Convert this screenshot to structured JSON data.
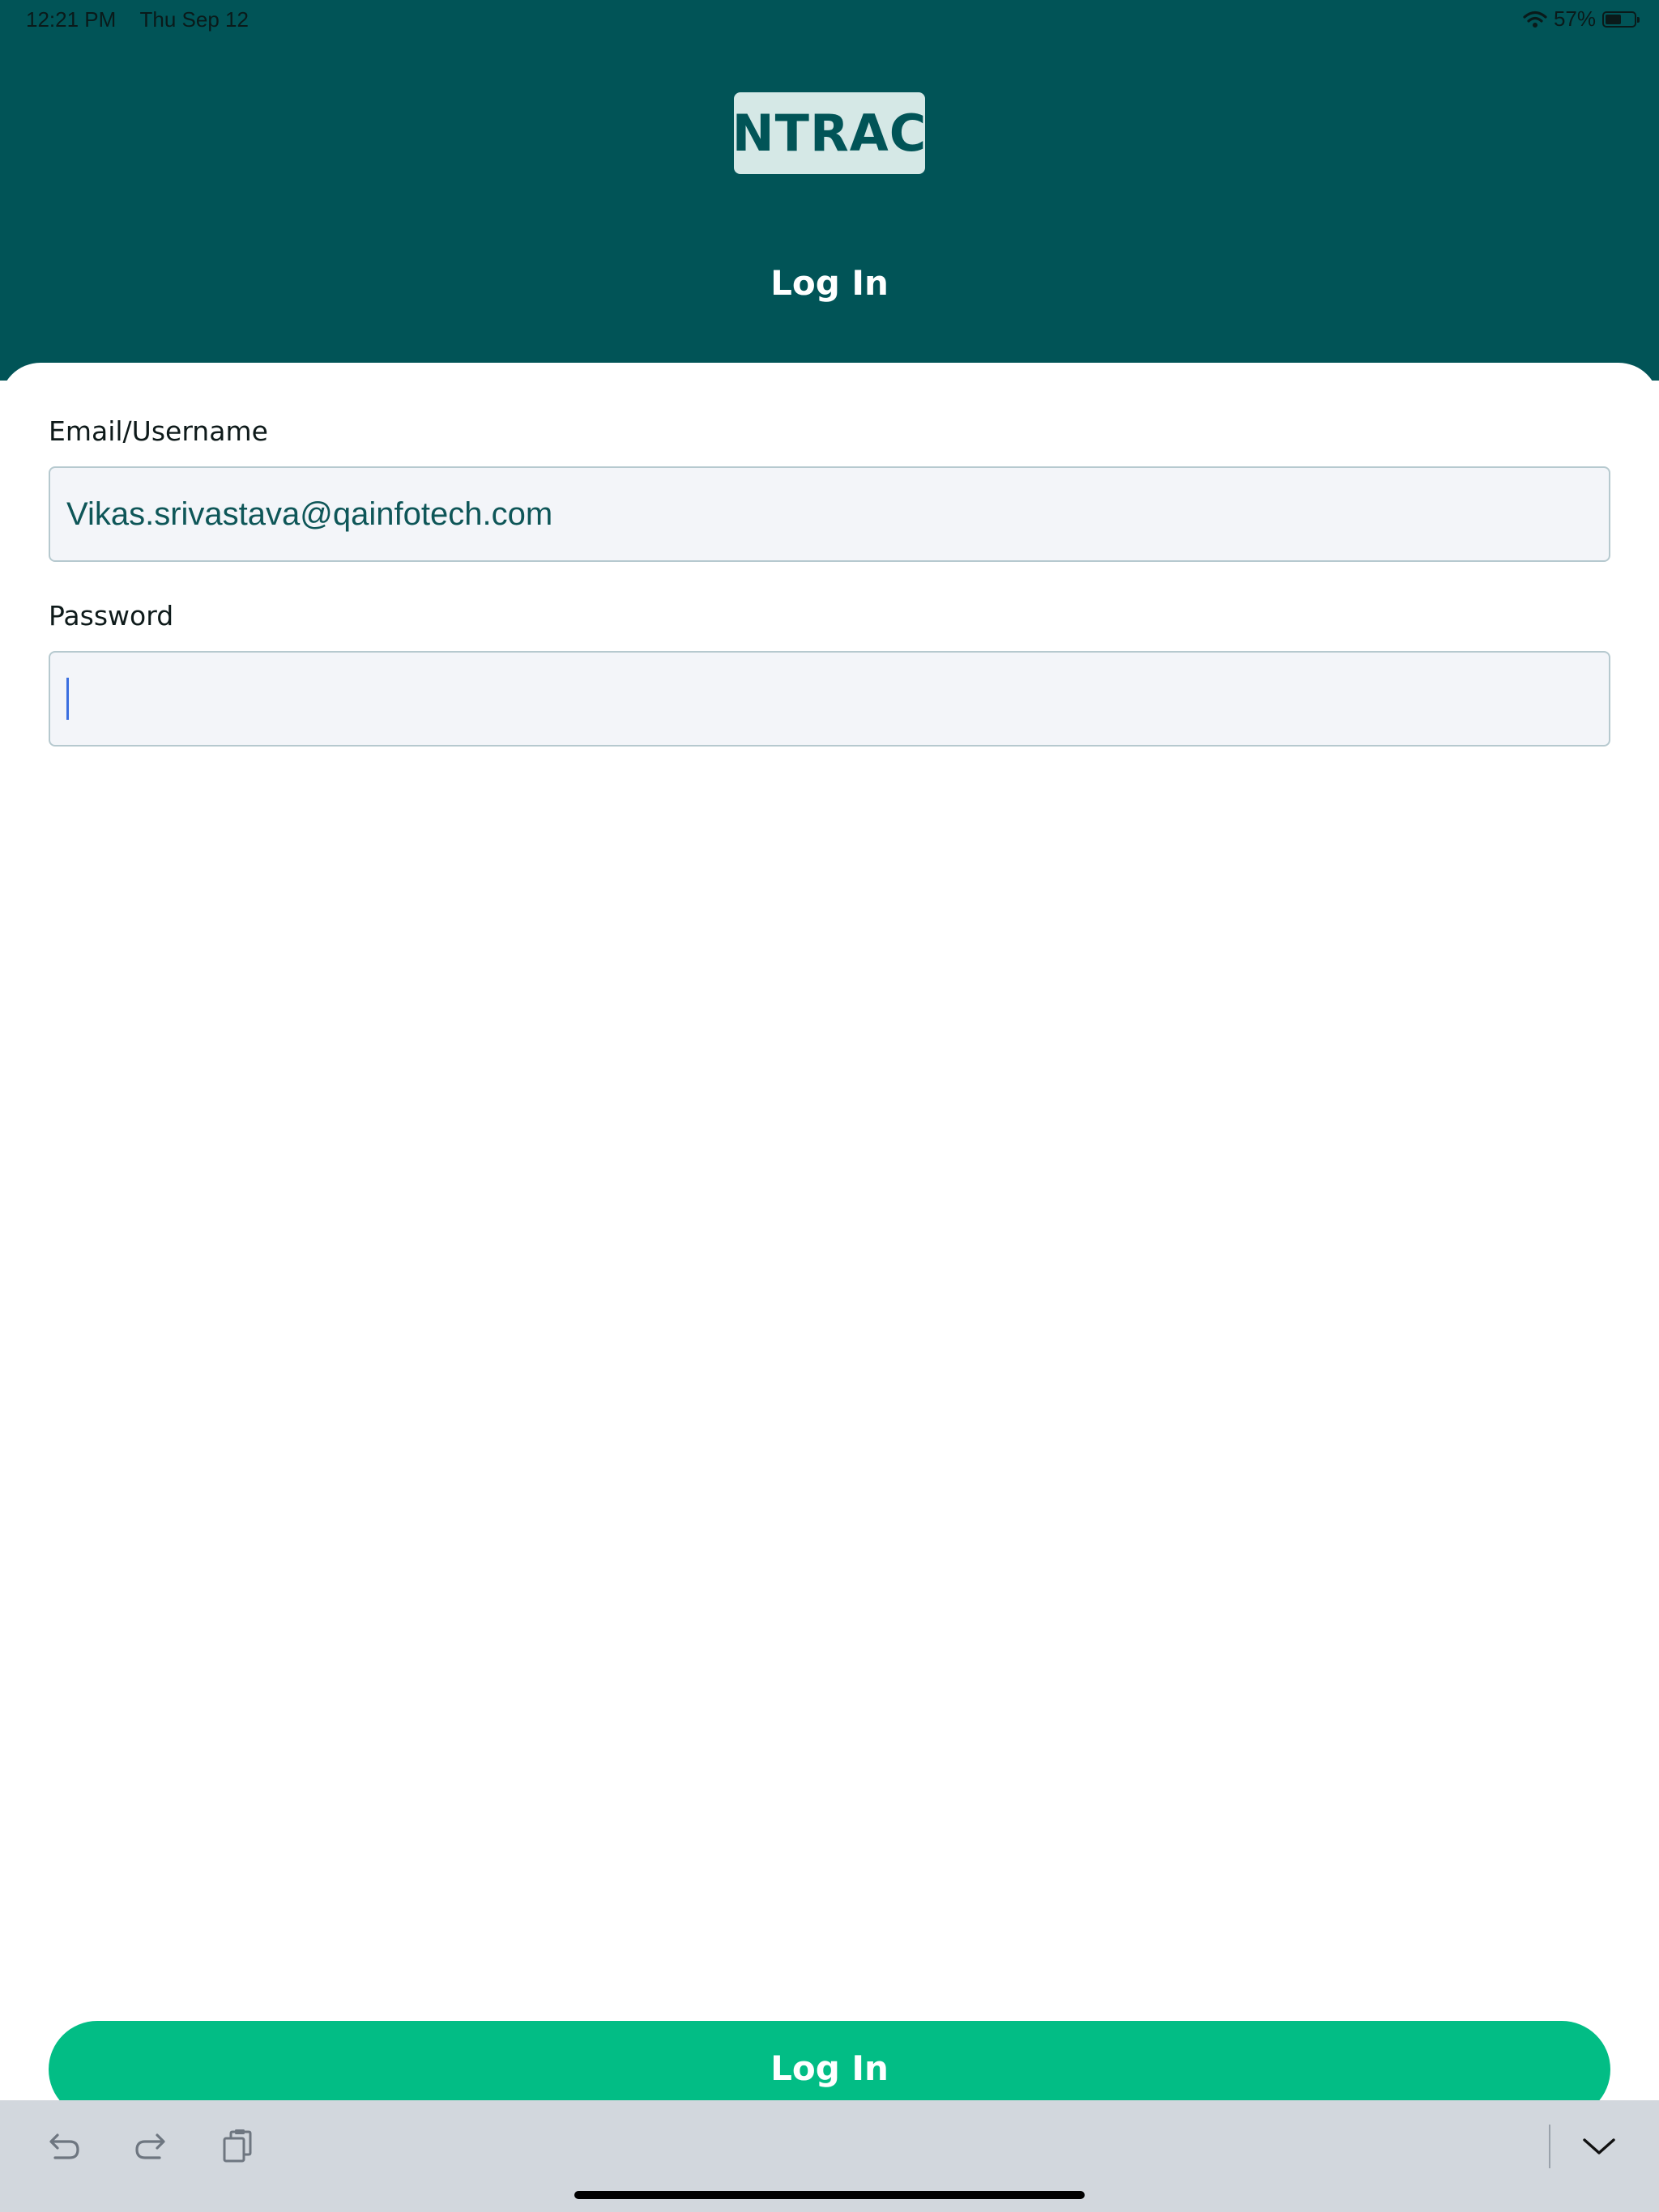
{
  "status_bar": {
    "time": "12:21 PM",
    "date": "Thu Sep 12",
    "battery": "57%",
    "battery_level": 0.57
  },
  "header": {
    "logo": "NTRAC",
    "title": "Log In"
  },
  "form": {
    "email_label": "Email/Username",
    "email_value": "Vikas.srivastava@qainfotech.com",
    "password_label": "Password",
    "password_value": ""
  },
  "login_button": {
    "label": "Log In"
  },
  "keyboard_bar": {
    "icons": [
      "undo-icon",
      "redo-icon",
      "paste-icon",
      "chevron-down-icon"
    ]
  },
  "colors": {
    "header_bg": "#015457",
    "logo_bg": "#d5e8e6",
    "button_bg": "#02bd85",
    "input_bg": "#f3f5f9"
  }
}
